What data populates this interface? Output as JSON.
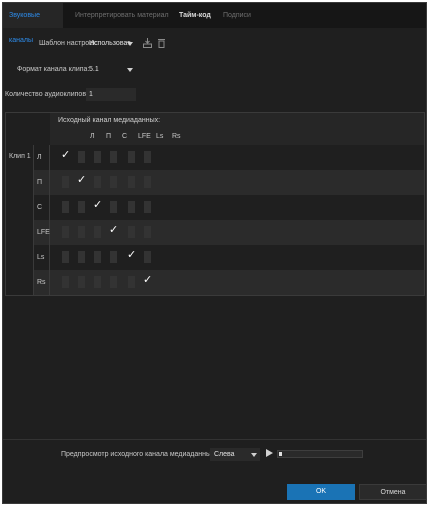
{
  "tabs": [
    {
      "label": "Звуковые каналы"
    },
    {
      "label": "Интерпретировать материал"
    },
    {
      "label": "Тайм-код"
    },
    {
      "label": "Подписи"
    }
  ],
  "preset": {
    "label": "Шаблон настроек:",
    "value": "Использоват"
  },
  "clip_format": {
    "label": "Формат канала клипа:",
    "value": "5.1"
  },
  "audio_clip_count": {
    "label": "Количество аудиоклипов:",
    "value": "1"
  },
  "matrix": {
    "header": "Исходный канал медиаданных:",
    "columns": [
      "Л",
      "П",
      "С",
      "LFE",
      "Ls",
      "Rs"
    ],
    "clip_label": "Клип 1",
    "rows": [
      {
        "name": "Л",
        "checked": 0
      },
      {
        "name": "П",
        "checked": 1
      },
      {
        "name": "С",
        "checked": 2
      },
      {
        "name": "LFE",
        "checked": 3
      },
      {
        "name": "Ls",
        "checked": 4
      },
      {
        "name": "Rs",
        "checked": 5
      }
    ],
    "check_glyph": "✓"
  },
  "preview": {
    "label": "Предпросмотр исходного канала медиаданных:",
    "value": "Слева"
  },
  "buttons": {
    "ok": "OK",
    "cancel": "Отмена"
  },
  "colors": {
    "accent": "#2d8ceb",
    "ok_button": "#1a73b5",
    "background": "#1f1f1f"
  }
}
